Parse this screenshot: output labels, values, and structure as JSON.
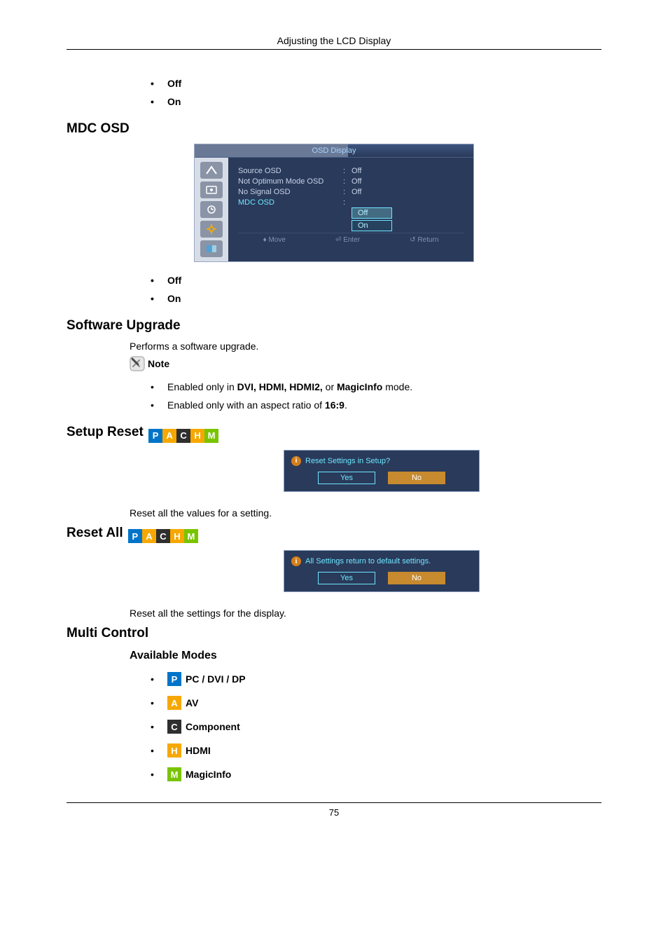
{
  "header": {
    "title": "Adjusting the LCD Display"
  },
  "list_off_on_1": {
    "off": "Off",
    "on": "On"
  },
  "mdc_osd": {
    "heading": "MDC OSD",
    "menu_title": "OSD Display",
    "rows": [
      {
        "k": "Source OSD",
        "v": "Off"
      },
      {
        "k": "Not Optimum Mode OSD",
        "v": "Off"
      },
      {
        "k": "No Signal OSD",
        "v": "Off"
      },
      {
        "k": "MDC OSD",
        "v": ""
      }
    ],
    "dropdown": {
      "off": "Off",
      "on": "On"
    },
    "footer": {
      "move": "Move",
      "enter": "Enter",
      "return": "Return"
    }
  },
  "list_off_on_2": {
    "off": "Off",
    "on": "On"
  },
  "software_upgrade": {
    "heading": "Software Upgrade",
    "desc": "Performs a software upgrade.",
    "note_label": "Note",
    "note1_pre": "Enabled only in ",
    "note1_bold": "DVI, HDMI, HDMI2,",
    "note1_mid": " or ",
    "note1_bold2": "MagicInfo",
    "note1_post": " mode.",
    "note2_pre": "Enabled only with an aspect ratio of ",
    "note2_bold": "16:9",
    "note2_post": "."
  },
  "setup_reset": {
    "heading": "Setup Reset",
    "dlg_text": "Reset Settings in Setup?",
    "yes": "Yes",
    "no": "No",
    "body": "Reset all the values for a setting."
  },
  "reset_all": {
    "heading": "Reset All",
    "dlg_text": "All Settings return to default settings.",
    "yes": "Yes",
    "no": "No",
    "body": "Reset all the settings for the display."
  },
  "multi_control": {
    "heading": "Multi Control",
    "sub": "Available Modes",
    "modes": {
      "p": "PC / DVI / DP",
      "a": "AV",
      "c": "Component",
      "h": "HDMI",
      "m": "MagicInfo"
    }
  },
  "badges": {
    "P": "P",
    "A": "A",
    "C": "C",
    "H": "H",
    "M": "M"
  },
  "footer": {
    "page": "75"
  }
}
